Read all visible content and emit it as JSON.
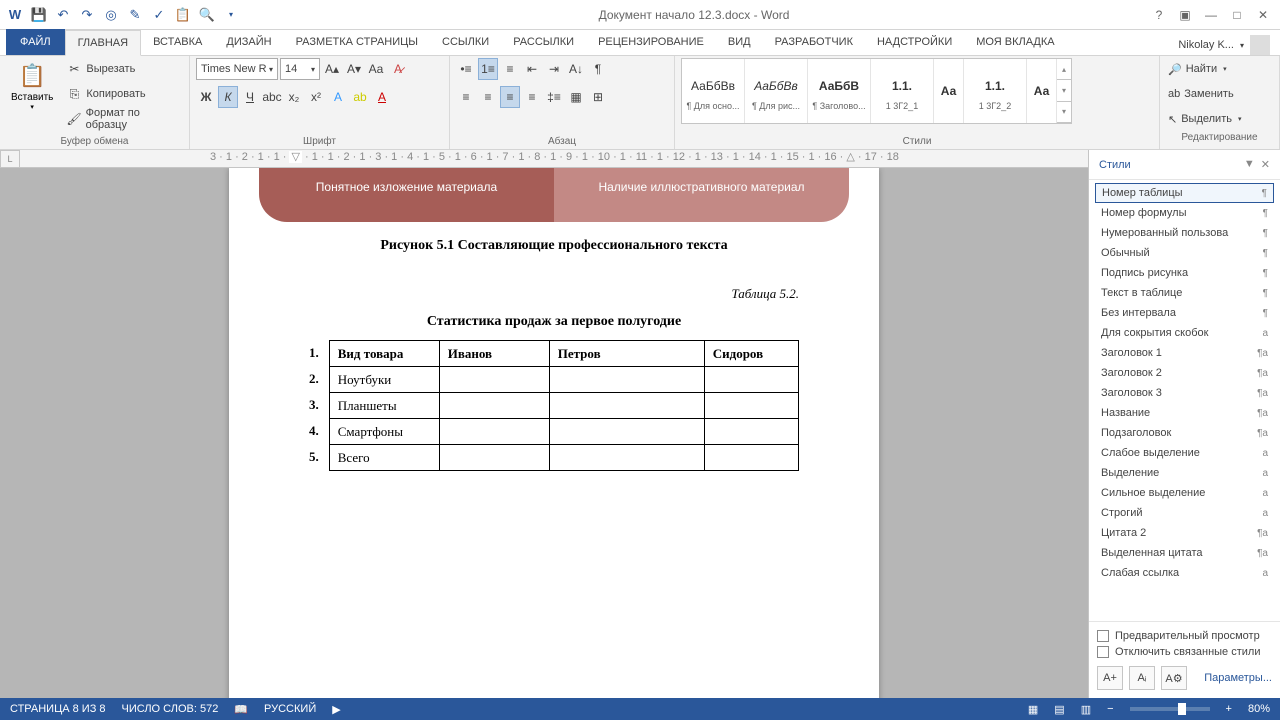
{
  "title": "Документ начало 12.3.docx - Word",
  "user": "Nikolay K...",
  "tabs": {
    "file": "ФАЙЛ",
    "home": "ГЛАВНАЯ",
    "insert": "ВСТАВКА",
    "design": "ДИЗАЙН",
    "layout": "РАЗМЕТКА СТРАНИЦЫ",
    "refs": "ССЫЛКИ",
    "mail": "РАССЫЛКИ",
    "review": "РЕЦЕНЗИРОВАНИЕ",
    "view": "ВИД",
    "dev": "РАЗРАБОТЧИК",
    "addins": "НАДСТРОЙКИ",
    "mytab": "МОЯ ВКЛАДКА"
  },
  "clipboard": {
    "paste": "Вставить",
    "cut": "Вырезать",
    "copy": "Копировать",
    "formatp": "Формат по образцу",
    "label": "Буфер обмена"
  },
  "font": {
    "name": "Times New R",
    "size": "14",
    "label": "Шрифт"
  },
  "para": {
    "label": "Абзац"
  },
  "gallery": [
    {
      "preview": "АаБбВв",
      "name": "¶ Для осно..."
    },
    {
      "preview": "АаБбВв",
      "name": "¶ Для рис..."
    },
    {
      "preview": "АаБбВ",
      "name": "¶ Заголово..."
    },
    {
      "preview": "1.1.",
      "name": "1 3Г2_1"
    },
    {
      "preview": "Аа",
      "name": ""
    },
    {
      "preview": "1.1.",
      "name": "1 3Г2_2"
    },
    {
      "preview": "Аа",
      "name": ""
    }
  ],
  "styles": {
    "label": "Стили"
  },
  "editing": {
    "find": "Найти",
    "replace": "Заменить",
    "select": "Выделить",
    "label": "Редактирование"
  },
  "doc": {
    "sa_left": "Понятное изложение материала",
    "sa_right": "Наличие иллюстративного материал",
    "caption": "Рисунок 5.1 Составляющие профессионального текста",
    "tbl_ref": "Таблица 5.2.",
    "tbl_title": "Статистика продаж за первое полугодие",
    "nums": [
      "1.",
      "2.",
      "3.",
      "4.",
      "5."
    ],
    "hdr": [
      "Вид товара",
      "Иванов",
      "Петров",
      "Сидоров"
    ],
    "rows": [
      "Ноутбуки",
      "Планшеты",
      "Смартфоны",
      "Всего"
    ]
  },
  "pane": {
    "title": "Стили",
    "items": [
      {
        "n": "Номер таблицы",
        "s": "¶",
        "sel": true
      },
      {
        "n": "Номер формулы",
        "s": "¶"
      },
      {
        "n": "Нумерованный пользова",
        "s": "¶"
      },
      {
        "n": "Обычный",
        "s": "¶"
      },
      {
        "n": "Подпись рисунка",
        "s": "¶"
      },
      {
        "n": "Текст в таблице",
        "s": "¶"
      },
      {
        "n": "Без интервала",
        "s": "¶"
      },
      {
        "n": "Для сокрытия скобок",
        "s": "a"
      },
      {
        "n": "Заголовок 1",
        "s": "¶a"
      },
      {
        "n": "Заголовок 2",
        "s": "¶a"
      },
      {
        "n": "Заголовок 3",
        "s": "¶a"
      },
      {
        "n": "Название",
        "s": "¶a"
      },
      {
        "n": "Подзаголовок",
        "s": "¶a"
      },
      {
        "n": "Слабое выделение",
        "s": "a"
      },
      {
        "n": "Выделение",
        "s": "a"
      },
      {
        "n": "Сильное выделение",
        "s": "a"
      },
      {
        "n": "Строгий",
        "s": "a"
      },
      {
        "n": "Цитата 2",
        "s": "¶a"
      },
      {
        "n": "Выделенная цитата",
        "s": "¶a"
      },
      {
        "n": "Слабая ссылка",
        "s": "a"
      }
    ],
    "preview": "Предварительный просмотр",
    "disable": "Отключить связанные стили",
    "params": "Параметры..."
  },
  "status": {
    "page": "СТРАНИЦА 8 ИЗ 8",
    "words": "ЧИСЛО СЛОВ: 572",
    "lang": "РУССКИЙ",
    "zoom": "80%"
  }
}
